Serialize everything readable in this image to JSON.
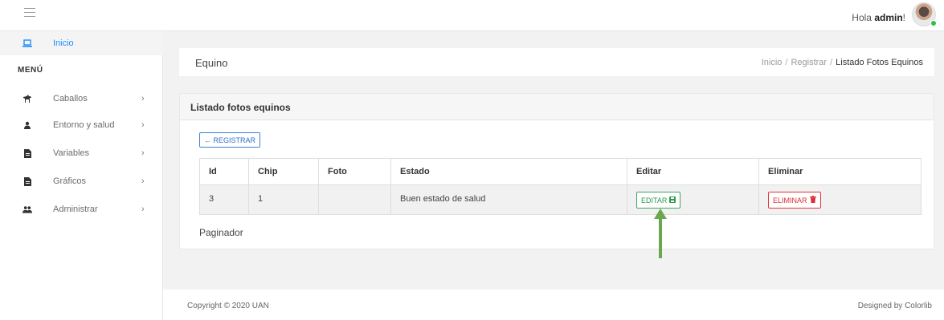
{
  "topbar": {
    "greeting_prefix": "Hola",
    "username": "admin",
    "greeting_suffix": "!"
  },
  "sidebar": {
    "home_label": "Inicio",
    "menu_title": "MENÚ",
    "items": [
      {
        "label": "Caballos",
        "icon": "horse-icon"
      },
      {
        "label": "Entorno y salud",
        "icon": "user-icon"
      },
      {
        "label": "Variables",
        "icon": "file-icon"
      },
      {
        "label": "Gráficos",
        "icon": "file-icon"
      },
      {
        "label": "Administrar",
        "icon": "users-icon"
      }
    ]
  },
  "header": {
    "title": "Equino",
    "breadcrumb": [
      "Inicio",
      "Registrar",
      "Listado Fotos Equinos"
    ]
  },
  "card": {
    "title": "Listado fotos equinos",
    "register_label": "← REGISTRAR",
    "columns": [
      "Id",
      "Chip",
      "Foto",
      "Estado",
      "Editar",
      "Eliminar"
    ],
    "rows": [
      {
        "id": "3",
        "chip": "1",
        "foto": "",
        "estado": "Buen estado de salud",
        "edit_label": "EDITAR",
        "delete_label": "ELIMINAR"
      }
    ],
    "paginator": "Paginador"
  },
  "footer": {
    "copyright": "Copyright © 2020 UAN",
    "designed_by": "Designed by Colorlib"
  },
  "colors": {
    "accent": "#1e90ff",
    "edit": "#2f9a4f",
    "delete": "#d9303a",
    "annotation_arrow": "#6aa84f"
  }
}
